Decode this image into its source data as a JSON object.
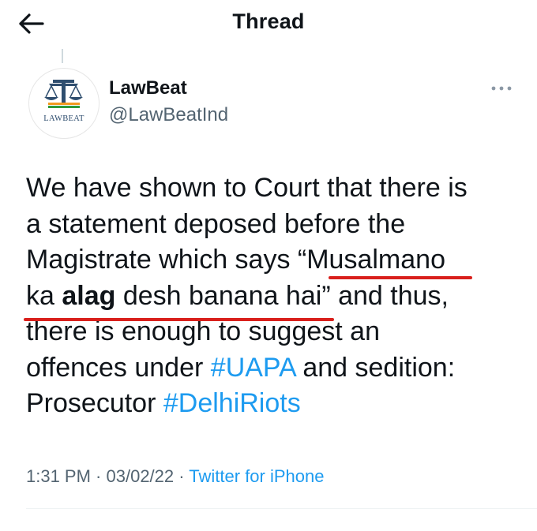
{
  "header": {
    "title": "Thread",
    "back_icon": "arrow-left-icon"
  },
  "author": {
    "name": "LawBeat",
    "handle": "@LawBeatInd",
    "avatar_label": "LAWBEAT",
    "avatar_icon": "scales-of-justice-icon"
  },
  "tweet": {
    "line1": "We have shown to Court that there is",
    "line2": "a statement deposed before the",
    "line3_a": "Magistrate which says “",
    "line3_b": "Musalmano",
    "line4_a": "ka ",
    "line4_bold": "alag",
    "line4_b": " desh banana hai",
    "line4_c": "” and thus,",
    "line5": "there is enough to suggest an",
    "line6_a": "offences under ",
    "line6_tag": "#UAPA",
    "line6_b": " and sedition:",
    "line7_a": "Prosecutor ",
    "line7_tag": "#DelhiRiots"
  },
  "meta": {
    "time": "1:31 PM",
    "sep": " · ",
    "date": "03/02/22",
    "source": "Twitter for iPhone"
  },
  "colors": {
    "link": "#1d9bf0",
    "underline_annotation": "#d9201c",
    "secondary_text": "#536471"
  }
}
